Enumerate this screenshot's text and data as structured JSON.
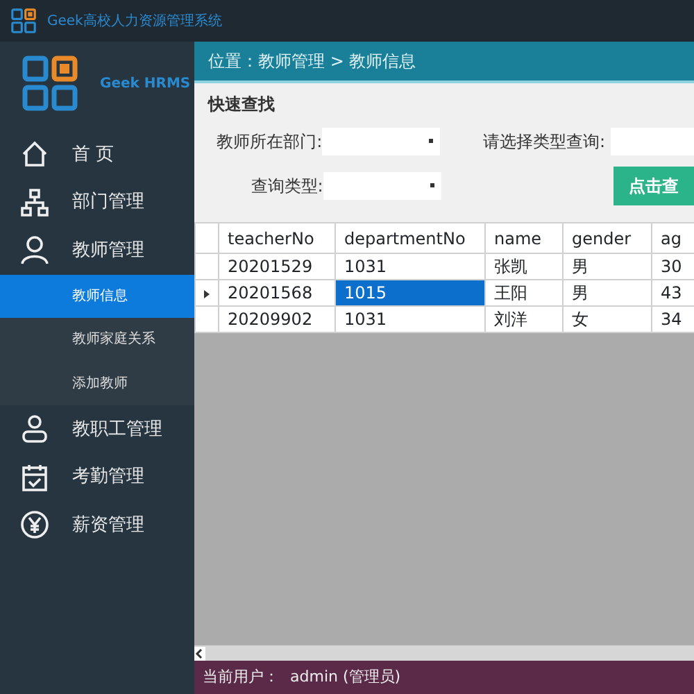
{
  "window": {
    "title": "Geek高校人力资源管理系统"
  },
  "sidebar": {
    "brand": "Geek HRMS",
    "items": [
      {
        "label": "首 页"
      },
      {
        "label": "部门管理"
      },
      {
        "label": "教师管理",
        "children": [
          {
            "label": "教师信息",
            "selected": true
          },
          {
            "label": "教师家庭关系",
            "selected": false
          },
          {
            "label": "添加教师",
            "selected": false
          }
        ]
      },
      {
        "label": "教职工管理"
      },
      {
        "label": "考勤管理"
      },
      {
        "label": "薪资管理"
      }
    ]
  },
  "breadcrumb": "位置：教师管理 > 教师信息",
  "search": {
    "title": "快速查找",
    "dept_label": "教师所在部门:",
    "type_label": "查询类型:",
    "query_label": "请选择类型查询:",
    "button": "点击查"
  },
  "table": {
    "columns": [
      "teacherNo",
      "departmentNo",
      "name",
      "gender",
      "ag"
    ],
    "rows": [
      {
        "current": false,
        "cells": [
          {
            "text": "20201529",
            "selected": false
          },
          {
            "text": "1031",
            "selected": false
          },
          {
            "text": "张凯",
            "selected": false
          },
          {
            "text": "男",
            "selected": false
          },
          {
            "text": "30",
            "selected": false
          }
        ]
      },
      {
        "current": true,
        "cells": [
          {
            "text": "20201568",
            "selected": false
          },
          {
            "text": "1015",
            "selected": true
          },
          {
            "text": "王阳",
            "selected": false
          },
          {
            "text": "男",
            "selected": false
          },
          {
            "text": "43",
            "selected": false
          }
        ]
      },
      {
        "current": false,
        "cells": [
          {
            "text": "20209902",
            "selected": false
          },
          {
            "text": "1031",
            "selected": false
          },
          {
            "text": "刘洋",
            "selected": false
          },
          {
            "text": "女",
            "selected": false
          },
          {
            "text": "34",
            "selected": false
          }
        ]
      }
    ]
  },
  "status_bar": {
    "label": "当前用户：",
    "user": "admin (管理员)"
  }
}
